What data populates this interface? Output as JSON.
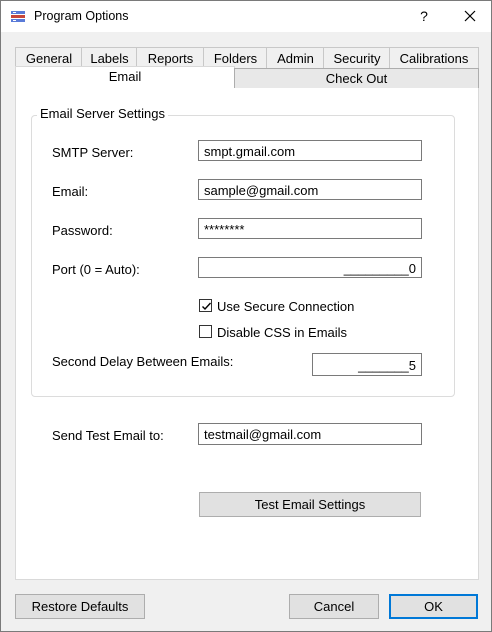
{
  "window": {
    "title": "Program Options",
    "help_label": "?"
  },
  "tabs_row1": [
    "General",
    "Labels",
    "Reports",
    "Folders",
    "Admin",
    "Security",
    "Calibrations"
  ],
  "tabs_row2": [
    "Email",
    "Check Out"
  ],
  "email": {
    "group_title": "Email Server Settings",
    "smtp_label": "SMTP Server:",
    "smtp_value": "smpt.gmail.com",
    "email_label": "Email:",
    "email_value": "sample@gmail.com",
    "password_label": "Password:",
    "password_value": "********",
    "port_label": "Port (0 = Auto):",
    "port_value": "_________0",
    "secure_label": "Use Secure Connection",
    "secure_checked": true,
    "disable_css_label": "Disable CSS in Emails",
    "disable_css_checked": false,
    "delay_label": "Second Delay Between Emails:",
    "delay_value": "_______5",
    "test_to_label": "Send Test Email to:",
    "test_to_value": "testmail@gmail.com",
    "test_button": "Test Email Settings"
  },
  "footer": {
    "restore_label": "Restore Defaults",
    "cancel_label": "Cancel",
    "ok_label": "OK"
  }
}
